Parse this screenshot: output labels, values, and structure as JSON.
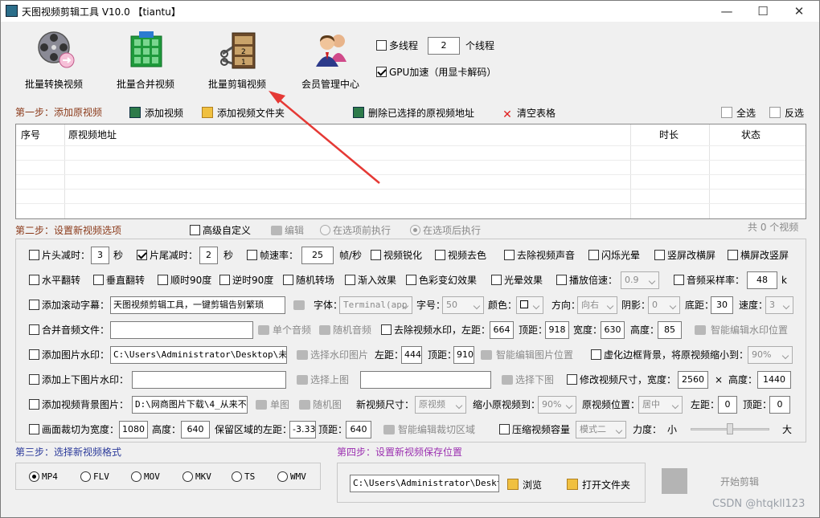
{
  "window": {
    "title": "天图视频剪辑工具 V10.0  【tiantu】",
    "minimize": "—",
    "maximize": "☐",
    "close": "✕"
  },
  "toolbar": {
    "batch_convert": "批量转换视频",
    "batch_merge": "批量合并视频",
    "batch_edit": "批量剪辑视频",
    "member_center": "会员管理中心",
    "multithread_label": "多线程",
    "thread_count": "2",
    "thread_unit": "个线程",
    "gpu_label": "GPU加速（用显卡解码）"
  },
  "step1": {
    "title": "第一步：添加原视频",
    "add_video": "添加视频",
    "add_folder": "添加视频文件夹",
    "delete_selected": "删除已选择的原视频地址",
    "clear_table": "清空表格",
    "select_all": "全选",
    "invert": "反选"
  },
  "table": {
    "columns": [
      "序号",
      "原视频地址",
      "时长",
      "状态"
    ],
    "count_text": "共 0 个视频"
  },
  "step2": {
    "title": "第二步：设置新视频选项",
    "advanced_custom": "高级自定义",
    "edit": "编辑",
    "before_exec": "在选项前执行",
    "after_exec": "在选项后执行"
  },
  "r1": {
    "head_cut": "片头减时：",
    "head_val": "3",
    "sec1": "秒",
    "tail_cut": "片尾减时：",
    "tail_val": "2",
    "sec2": "秒",
    "framerate": "帧速率：",
    "framerate_val": "25",
    "fps_unit": "帧/秒",
    "sharpen": "视频锐化",
    "decolor": "视频去色",
    "remove_audio": "去除视频声音",
    "flash": "闪烁光晕",
    "v2h": "竖屏改横屏",
    "h2v": "横屏改竖屏"
  },
  "r2": {
    "hflip": "水平翻转",
    "vflip": "垂直翻转",
    "rot_cw": "顺时90度",
    "rot_ccw": "逆时90度",
    "random_trans": "随机转场",
    "fade_in": "渐入效果",
    "color_shift": "色彩变幻效果",
    "halo": "光晕效果",
    "speed": "播放倍速：",
    "speed_val": "0.9",
    "samplerate": "音频采样率：",
    "samplerate_val": "48",
    "k": "k"
  },
  "r3": {
    "scroll_sub": "添加滚动字幕：",
    "scroll_text": "天图视频剪辑工具，一键剪辑告别繁琐",
    "font_label": "字体：",
    "font_val": "Terminal(app",
    "size_label": "字号：",
    "size_val": "50",
    "color_label": "颜色：",
    "dir_label": "方向：",
    "dir_val": "向右",
    "shadow_label": "阴影：",
    "shadow_val": "0",
    "bottom_label": "底距：",
    "bottom_val": "30",
    "speed_label": "速度：",
    "speed_val": "3"
  },
  "r4": {
    "merge_audio": "合并音频文件：",
    "single_audio": "单个音频",
    "random_audio": "随机音频",
    "remove_wm": "去除视频水印，左距：",
    "left_val": "664",
    "top_label": "顶距：",
    "top_val": "918",
    "width_label": "宽度：",
    "width_val": "630",
    "height_label": "高度：",
    "height_val": "85",
    "smart_wm": "智能编辑水印位置"
  },
  "r5": {
    "img_wm": "添加图片水印：",
    "img_path": "C:\\Users\\Administrator\\Desktop\\未标题",
    "choose_wm": "选择水印图片",
    "left_label": "左距：",
    "left_val": "444",
    "top_label": "顶距：",
    "top_val": "910",
    "smart_img": "智能编辑图片位置",
    "blur_border": "虚化边框背景，将原视频缩小到：",
    "shrink_val": "90%"
  },
  "r6": {
    "updown_wm": "添加上下图片水印：",
    "choose_up": "选择上图",
    "choose_down": "选择下图",
    "resize": "修改视频尺寸，宽度：",
    "w_val": "2560",
    "times": "×",
    "h_label": "高度：",
    "h_val": "1440"
  },
  "r7": {
    "bg_img": "添加视频背景图片：",
    "bg_path": "D:\\网商图片下载\\4_从来不",
    "single_img": "单图",
    "random_img": "随机图",
    "new_size": "新视频尺寸：",
    "new_size_val": "原视频",
    "shrink": "缩小原视频到：",
    "shrink_val": "90%",
    "pos": "原视频位置：",
    "pos_val": "居中",
    "left_label": "左距：",
    "left_val": "0",
    "top_label": "顶距：",
    "top_val": "0"
  },
  "r8": {
    "crop": "画面裁切为宽度：",
    "crop_w": "1080",
    "h_label": "高度：",
    "crop_h": "640",
    "keep_left": "保留区域的左距：",
    "keep_left_val": "-3.33",
    "top_label": "顶距：",
    "top_val": "640",
    "smart_crop": "智能编辑裁切区域",
    "compress": "压缩视频容量",
    "mode_val": "模式二",
    "strength": "力度：",
    "small": "小",
    "big": "大"
  },
  "step3": {
    "title": "第三步：选择新视频格式",
    "formats": [
      "MP4",
      "FLV",
      "MOV",
      "MKV",
      "TS",
      "WMV"
    ]
  },
  "step4": {
    "title": "第四步：设置新视频保存位置",
    "path": "C:\\Users\\Administrator\\Desktop\\",
    "browse": "浏览",
    "open_folder": "打开文件夹",
    "start": "开始剪辑"
  },
  "watermark": "CSDN @htqkll123",
  "colors": {
    "step": "#8b3a1a",
    "step4": "#9b30b0",
    "arrow": "#e53935"
  },
  "slider_level": 0.5
}
